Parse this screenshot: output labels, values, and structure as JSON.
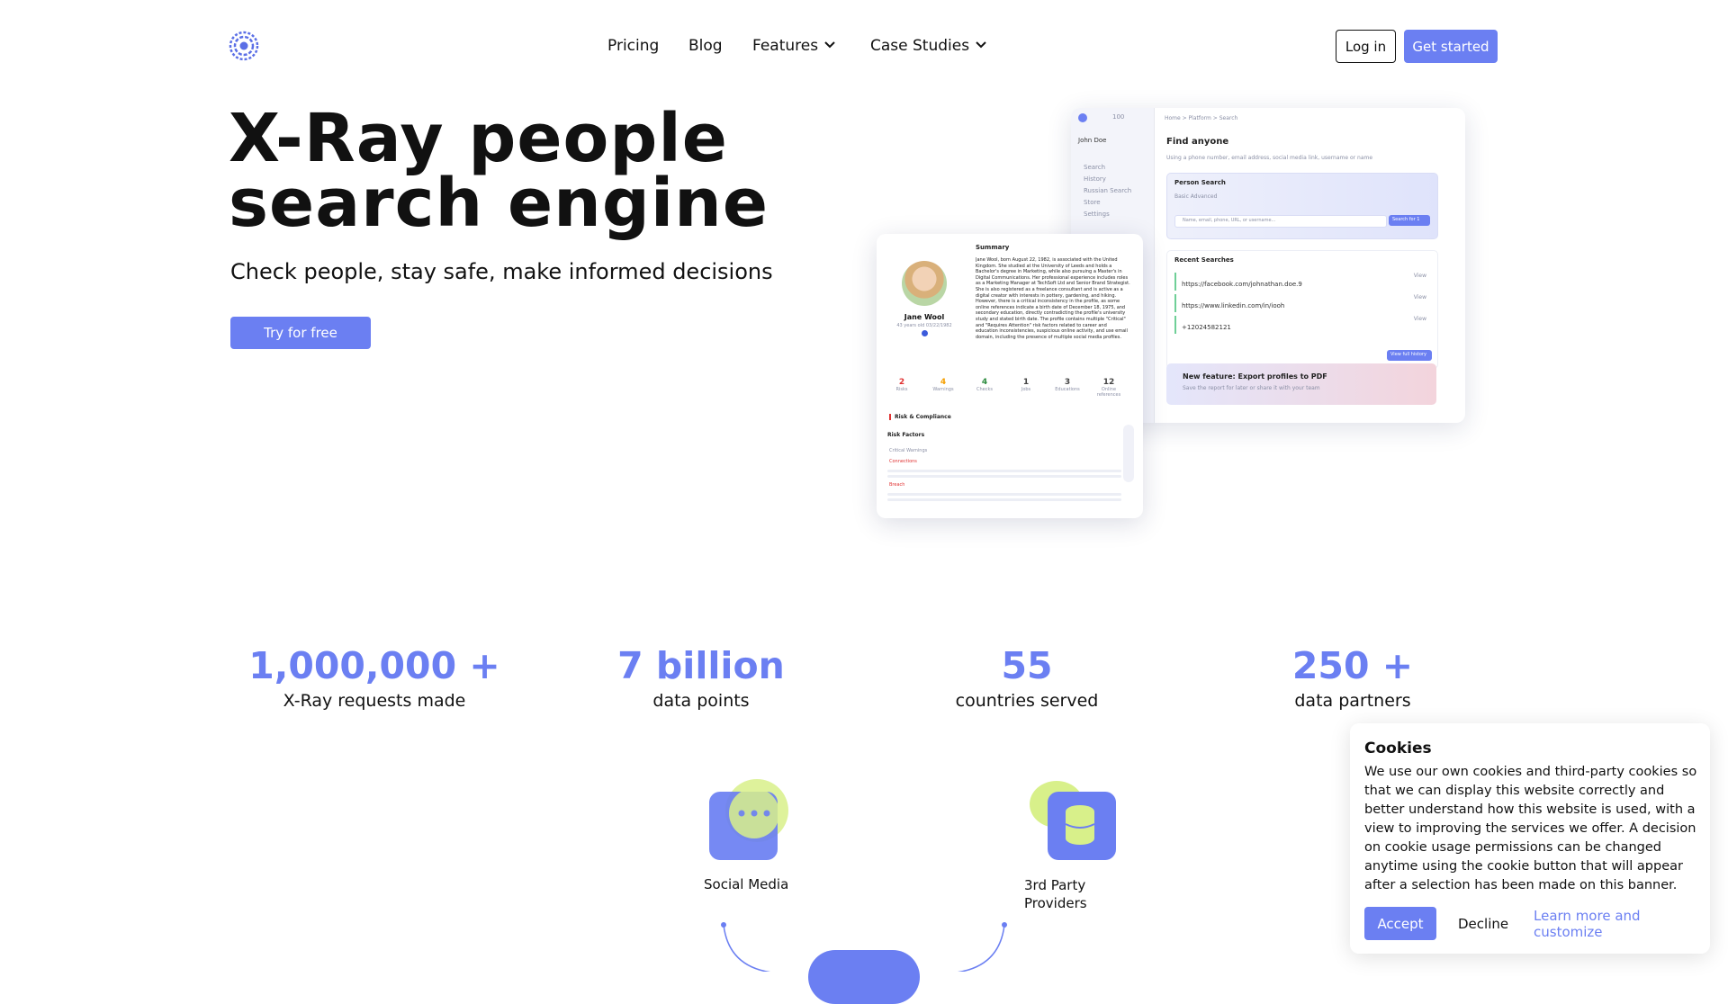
{
  "brand": {
    "accent": "#6b7ff2",
    "logo_icon": "eye-spiral-icon"
  },
  "nav": {
    "items": [
      "Pricing",
      "Blog",
      "Features",
      "Case Studies"
    ],
    "login": "Log in",
    "get_started": "Get started"
  },
  "hero": {
    "title_line1": "X-Ray people",
    "title_line2": "search engine",
    "subtitle": "Check people, stay safe, make informed decisions",
    "cta": "Try for free"
  },
  "mock": {
    "credits": "100",
    "user_name": "John Doe",
    "breadcrumb": "Home  >  Platform  >  Search",
    "page_title": "Find anyone",
    "page_hint": "Using a phone number, email address, social media link, username or name",
    "sidebar": [
      "Search",
      "History",
      "Russian Search",
      "Store",
      "Settings"
    ],
    "search_panel_title": "Person Search",
    "search_toggle": "Basic    Advanced",
    "search_placeholder": "Name, email, phone, URL, or username...",
    "search_button": "Search for 1",
    "recent_title": "Recent Searches",
    "recent": [
      "https://facebook.com/johnathan.doe.9",
      "https://www.linkedin.com/in/iooh",
      "+12024582121"
    ],
    "recent_action": "View",
    "view_history": "View full history",
    "banner_title": "New feature: Export profiles to PDF",
    "banner_sub": "Save the report for later or share it with your team",
    "profile_name": "Jane Wool",
    "profile_meta": "43 years old 03/22/1982",
    "summary_title": "Summary",
    "summary_text": "Jane Wool, born August 22, 1982, is associated with the United Kingdom. She studied at the University of Leeds and holds a Bachelor's degree in Marketing, while also pursuing a Master's in Digital Communications. Her professional experience includes roles as a Marketing Manager at TechSoft Ltd and Senior Brand Strategist. She is also registered as a freelance consultant and is active as a digital creator with interests in pottery, gardening, and hiking. However, there is a critical inconsistency in the profile, as some online references indicate a birth date of December 18, 1975, and secondary education, directly contradicting the profile's university study and stated birth date. The profile contains multiple \"Critical\" and \"Requires Attention\" risk factors related to career and education inconsistencies, suspicious online activity, and use email domain, including the presence of multiple social media profiles.",
    "profile_stats": [
      {
        "value": "2",
        "label": "Risks"
      },
      {
        "value": "4",
        "label": "Warnings"
      },
      {
        "value": "4",
        "label": "Checks"
      },
      {
        "value": "1",
        "label": "Jobs"
      },
      {
        "value": "3",
        "label": "Educations"
      },
      {
        "value": "12",
        "label": "Online references"
      }
    ],
    "risk_section": "Risk & Compliance",
    "risk_factors": "Risk Factors",
    "risk_tabs": "Critical    Warnings",
    "risk_items": [
      "Connections",
      "Breach"
    ]
  },
  "stats": [
    {
      "value": "1,000,000 +",
      "label": "X-Ray requests made"
    },
    {
      "value": "7 billion",
      "label": "data points"
    },
    {
      "value": "55",
      "label": "countries served"
    },
    {
      "value": "250 +",
      "label": "data partners"
    }
  ],
  "diagram": {
    "social": "Social Media",
    "third_party_line1": "3rd Party",
    "third_party_line2": "Providers",
    "social_icon": "chat-bubble-icon",
    "providers_icon": "database-icon"
  },
  "cookies": {
    "title": "Cookies",
    "body": "We use our own cookies and third-party cookies so that we can display this website correctly and better understand how this website is used, with a view to improving the services we offer. A decision on cookie usage permissions can be changed anytime using the cookie button that will appear after a selection has been made on this banner.",
    "accept": "Accept",
    "decline": "Decline",
    "learn": "Learn more and customize"
  }
}
